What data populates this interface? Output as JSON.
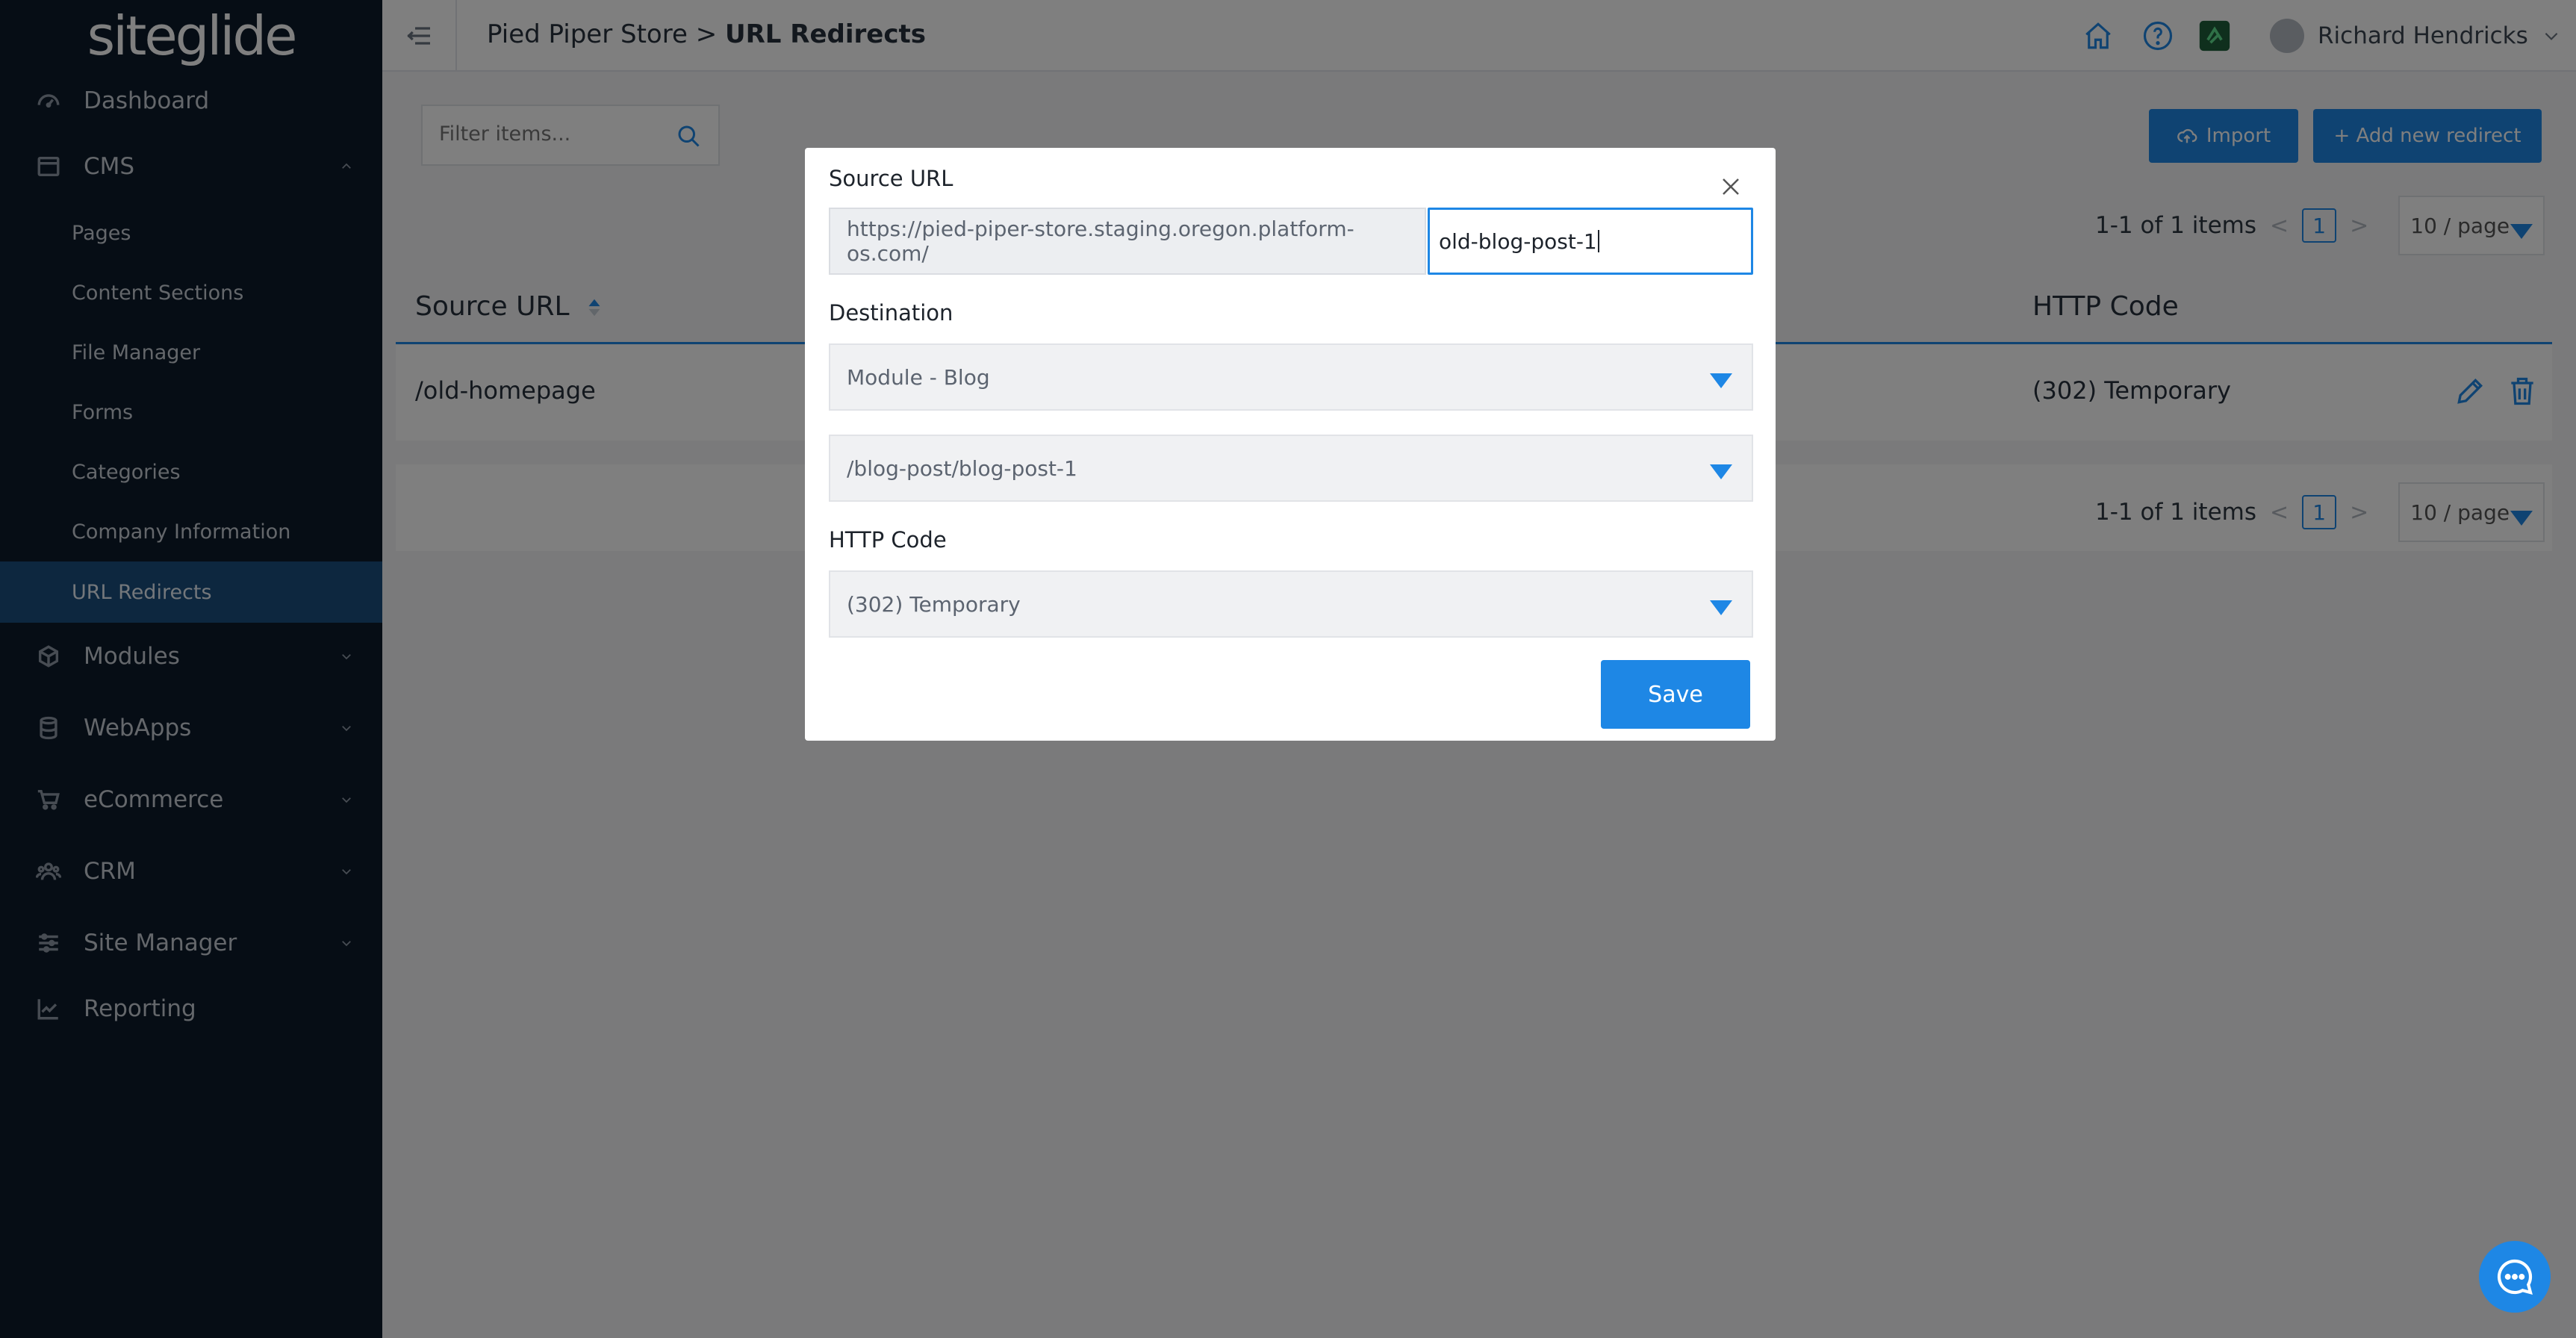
{
  "app": {
    "logo": "siteglide"
  },
  "sidebar": {
    "items": [
      {
        "label": "Dashboard",
        "icon": "dashboard-icon"
      },
      {
        "label": "CMS",
        "icon": "cms-icon",
        "expanded": true
      },
      {
        "label": "Modules",
        "icon": "cube-icon"
      },
      {
        "label": "WebApps",
        "icon": "database-icon"
      },
      {
        "label": "eCommerce",
        "icon": "cart-icon"
      },
      {
        "label": "CRM",
        "icon": "users-icon"
      },
      {
        "label": "Site Manager",
        "icon": "sliders-icon"
      },
      {
        "label": "Reporting",
        "icon": "chart-icon"
      }
    ],
    "cms_sub": [
      "Pages",
      "Content Sections",
      "File Manager",
      "Forms",
      "Categories",
      "Company Information",
      "URL Redirects"
    ],
    "active_sub": "URL Redirects"
  },
  "header": {
    "site": "Pied Piper Store",
    "separator": ">",
    "page": "URL Redirects",
    "user_name": "Richard Hendricks"
  },
  "toolbar": {
    "filter_placeholder": "Filter items...",
    "import_label": "Import",
    "add_label": "+ Add new redirect"
  },
  "pagination": {
    "summary": "1-1 of 1 items",
    "current_page": "1",
    "per_page": "10 / page",
    "prev": "<",
    "next": ">"
  },
  "table": {
    "columns": [
      "Source URL",
      "HTTP Code"
    ],
    "rows": [
      {
        "source": "/old-homepage",
        "code": "(302) Temporary"
      }
    ]
  },
  "modal": {
    "source_label": "Source URL",
    "source_prefix": "https://pied-piper-store.staging.oregon.platform-os.com/",
    "source_value": "old-blog-post-1",
    "destination_label": "Destination",
    "destination_type": "Module - Blog",
    "destination_item": "/blog-post/blog-post-1",
    "http_label": "HTTP Code",
    "http_value": "(302) Temporary",
    "save_label": "Save"
  },
  "colors": {
    "accent": "#1e87e5",
    "sidebar_bg": "#0d1b2a",
    "sidebar_active": "#1b4f7e"
  }
}
